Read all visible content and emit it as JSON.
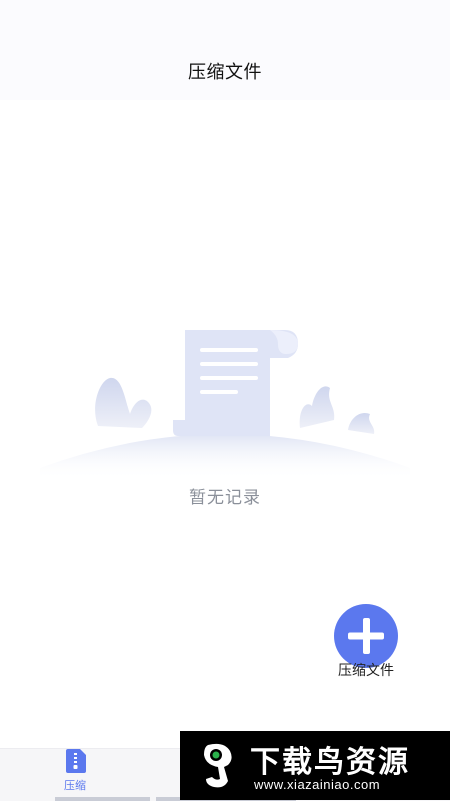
{
  "header": {
    "title": "压缩文件"
  },
  "empty_state": {
    "message": "暂无记录",
    "illustration_icon": "document-scroll-icon"
  },
  "fab": {
    "label": "压缩文件",
    "icon": "plus-icon",
    "color": "#5b78ee"
  },
  "bottom_nav": {
    "items": [
      {
        "label": "压缩",
        "icon": "zip-file-icon",
        "active": true
      }
    ],
    "active_color": "#5b78ee"
  },
  "watermark": {
    "title": "下载鸟资源",
    "url": "www.xiazainiao.com"
  }
}
